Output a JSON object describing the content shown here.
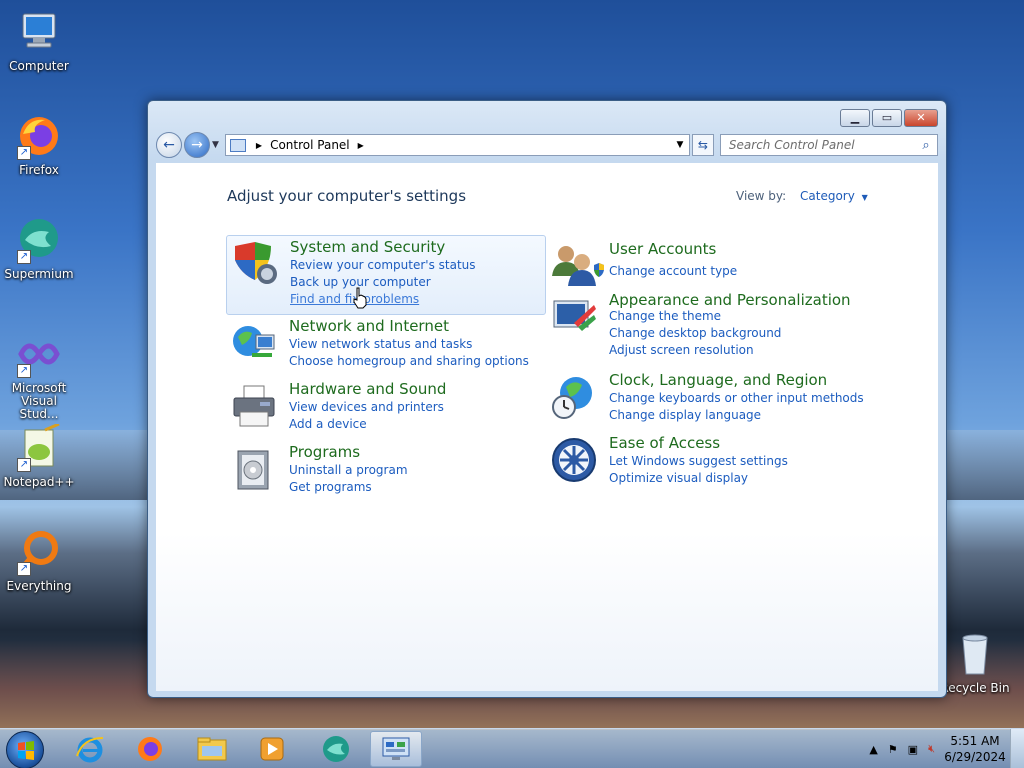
{
  "desktop": {
    "icons": [
      {
        "label": "Computer",
        "icon": "computer-icon"
      },
      {
        "label": "Firefox",
        "icon": "firefox-icon"
      },
      {
        "label": "Supermium",
        "icon": "supermium-icon"
      },
      {
        "label": "Microsoft Visual Stud...",
        "icon": "visual-studio-icon"
      },
      {
        "label": "Notepad++",
        "icon": "notepadpp-icon"
      },
      {
        "label": "Everything",
        "icon": "everything-icon"
      },
      {
        "label": "Recycle Bin",
        "icon": "recycle-bin-icon"
      }
    ]
  },
  "window": {
    "address": {
      "location": "Control Panel"
    },
    "search": {
      "placeholder": "Search Control Panel"
    },
    "heading": "Adjust your computer's settings",
    "view_by": {
      "label": "View by:",
      "value": "Category"
    },
    "categories": {
      "system_security": {
        "title": "System and Security",
        "links": [
          "Review your computer's status",
          "Back up your computer",
          "Find and fix problems"
        ]
      },
      "network": {
        "title": "Network and Internet",
        "links": [
          "View network status and tasks",
          "Choose homegroup and sharing options"
        ]
      },
      "hardware": {
        "title": "Hardware and Sound",
        "links": [
          "View devices and printers",
          "Add a device"
        ]
      },
      "programs": {
        "title": "Programs",
        "links": [
          "Uninstall a program",
          "Get programs"
        ]
      },
      "user_accounts": {
        "title": "User Accounts",
        "links": [
          "Change account type"
        ]
      },
      "appearance": {
        "title": "Appearance and Personalization",
        "links": [
          "Change the theme",
          "Change desktop background",
          "Adjust screen resolution"
        ]
      },
      "clock": {
        "title": "Clock, Language, and Region",
        "links": [
          "Change keyboards or other input methods",
          "Change display language"
        ]
      },
      "ease": {
        "title": "Ease of Access",
        "links": [
          "Let Windows suggest settings",
          "Optimize visual display"
        ]
      }
    }
  },
  "taskbar": {
    "pinned": [
      "internet-explorer-icon",
      "firefox-icon",
      "file-explorer-icon",
      "media-player-icon",
      "supermium-icon",
      "control-panel-icon"
    ],
    "clock": {
      "time": "5:51 AM",
      "date": "6/29/2024"
    }
  },
  "colors": {
    "category_title": "#1e6b1e",
    "link": "#1c5cbf",
    "heading": "#1e395b"
  }
}
